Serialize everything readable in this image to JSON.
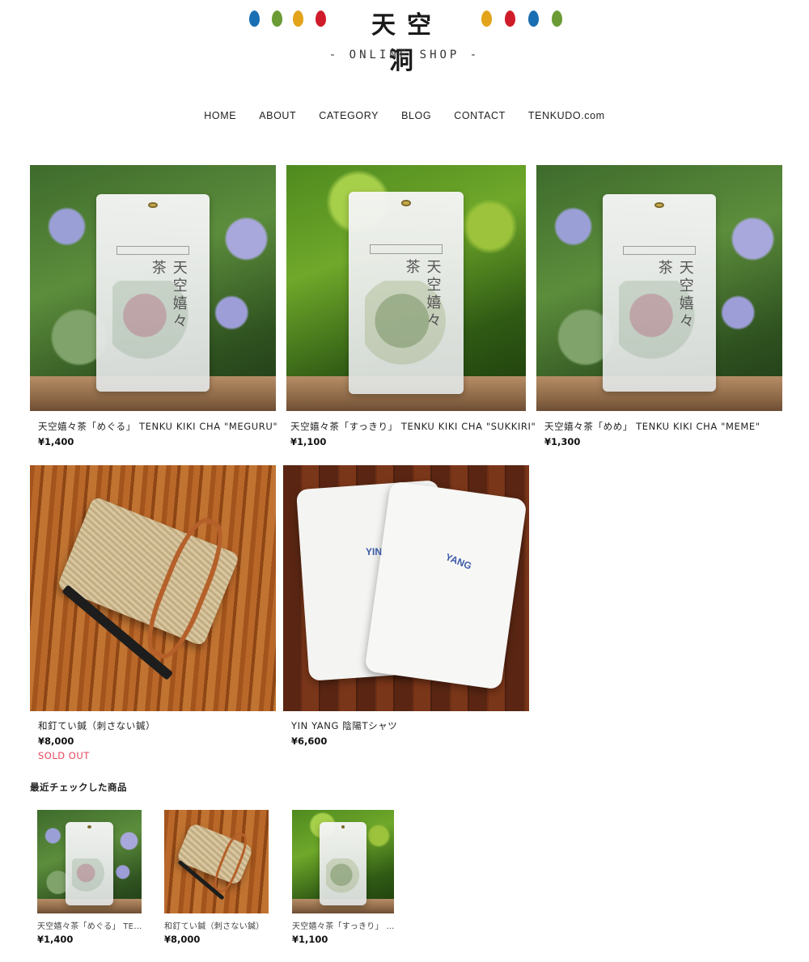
{
  "header": {
    "brand": "天空洞",
    "subtitle": "- ONLINE SHOP -",
    "dot_colors_left": [
      "#1a6fb3",
      "#6a9b34",
      "#e3a31a",
      "#d01c2a"
    ],
    "dot_colors_right": [
      "#e3a31a",
      "#d01c2a",
      "#1a6fb3",
      "#6a9b34"
    ]
  },
  "nav": {
    "items": [
      {
        "label": "HOME"
      },
      {
        "label": "ABOUT"
      },
      {
        "label": "CATEGORY"
      },
      {
        "label": "BLOG"
      },
      {
        "label": "CONTACT"
      },
      {
        "label": "TENKUDO.com"
      }
    ]
  },
  "products": [
    {
      "name": "天空嬉々茶「めぐる」 TENKU KIKI CHA \"MEGURU\"",
      "price": "¥1,400",
      "status": ""
    },
    {
      "name": "天空嬉々茶「すっきり」 TENKU KIKI CHA \"SUKKIRI\"",
      "price": "¥1,100",
      "status": ""
    },
    {
      "name": "天空嬉々茶「めめ」 TENKU KIKI CHA \"MEME\"",
      "price": "¥1,300",
      "status": ""
    },
    {
      "name": "和釘てい鍼（刺さない鍼）",
      "price": "¥8,000",
      "status": "SOLD OUT"
    },
    {
      "name": "YIN YANG 陰陽Tシャツ",
      "price": "¥6,600",
      "status": ""
    }
  ],
  "photo_text": {
    "pack_kanji": "天空嬉々茶",
    "shirt_left": "YIN",
    "shirt_right": "YANG"
  },
  "recent": {
    "title": "最近チェックした商品",
    "items": [
      {
        "name": "天空嬉々茶「めぐる」 TEN...",
        "price": "¥1,400"
      },
      {
        "name": "和釘てい鍼（刺さない鍼）",
        "price": "¥8,000"
      },
      {
        "name": "天空嬉々茶「すっきり」 T...",
        "price": "¥1,100"
      }
    ]
  },
  "colors": {
    "sold_out": "#e8455a",
    "text": "#222222"
  }
}
